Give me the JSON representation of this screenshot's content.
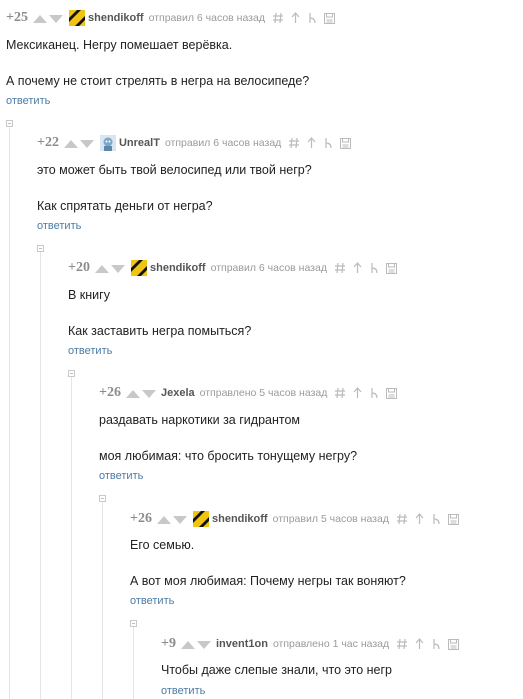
{
  "comments": [
    {
      "rating": "+25",
      "username": "shendikoff",
      "meta": "отправил 6 часов назад",
      "avatar": "hazard-stripe-avatar",
      "texts": [
        "Мексиканец. Негру помешает верёвка.",
        "А почему не стоит стрелять в негра на велосипеде?"
      ],
      "reply": "ответить"
    },
    {
      "rating": "+22",
      "username": "UnrealT",
      "meta": "отправил 6 часов назад",
      "avatar": "robot-avatar",
      "texts": [
        "это может быть твой велосипед или твой негр?",
        "Как спрятать деньги от негра?"
      ],
      "reply": "ответить"
    },
    {
      "rating": "+20",
      "username": "shendikoff",
      "meta": "отправил 6 часов назад",
      "avatar": "hazard-stripe-avatar",
      "texts": [
        "В книгу",
        "Как заставить негра помыться?"
      ],
      "reply": "ответить"
    },
    {
      "rating": "+26",
      "username": "Jexela",
      "meta": "отправлено 5 часов назад",
      "avatar": "",
      "texts": [
        "раздавать наркотики за гидрантом",
        "моя любимая: что бросить тонущему негру?"
      ],
      "reply": "ответить"
    },
    {
      "rating": "+26",
      "username": "shendikoff",
      "meta": "отправил 5 часов назад",
      "avatar": "hazard-stripe-avatar",
      "texts": [
        "Его семью.",
        "А вот моя любимая: Почему негры так воняют?"
      ],
      "reply": "ответить"
    },
    {
      "rating": "+9",
      "username": "invent1on",
      "meta": "отправлено 1 час назад",
      "avatar": "",
      "texts": [
        "Чтобы даже слепые знали, что это негр"
      ],
      "reply": "ответить"
    }
  ],
  "icons": {
    "vote_up": "arrow-up-icon",
    "vote_down": "arrow-down-icon",
    "tools": [
      "hash-link-icon",
      "parent-arrow-icon",
      "branch-icon",
      "save-icon"
    ]
  },
  "colors": {
    "rating": "#8c8c8c",
    "reply_link": "#4b7ba5",
    "meta": "#9a9a9a",
    "username": "#555555"
  }
}
